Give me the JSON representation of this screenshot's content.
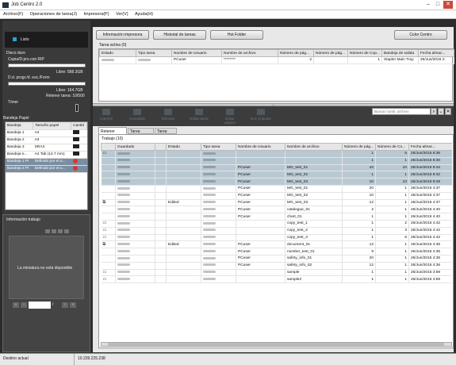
{
  "app": {
    "title": "Job Centro 2.0"
  },
  "window_controls": {
    "min": "–",
    "max": "□",
    "close": "✕"
  },
  "menu": [
    "Archivo(F)",
    "Operaciones de tarea(J)",
    "Impresora(P)",
    "Ver(V)",
    "Ayuda(H)"
  ],
  "left": {
    "status": "Listo",
    "disco_duro": "Disco duro",
    "copia_label": "Copia/D.pro.con RIP",
    "libre1": "Libre: 588.3GB",
    "dd_label": "D.d. progr./d. esc./Form",
    "libre2": "Libre: 164.7GB",
    "retener": "Retener tarea: 10/500",
    "toner": "Tóner",
    "bandeja_title": "Bandeja Papel",
    "bandeja_headers": [
      "Bandeja",
      "Tamaño papel",
      "Cantid"
    ],
    "bandejas": [
      [
        "Bandeja 1",
        "A4"
      ],
      [
        "Bandeja 2",
        "A3"
      ],
      [
        "Bandeja 3",
        "SRA3"
      ],
      [
        "Bandeja e...",
        "A4 Tab (12.7 mm)"
      ],
      [
        "Bandeja 1 PI",
        "Definido por el u..."
      ],
      [
        "Bandeja 2 PI",
        "Definido por el u..."
      ]
    ],
    "info_title": "Información trabajo",
    "miniatura": "La miniatura no está disponible",
    "page_sep": "/"
  },
  "toolbar": {
    "info": "Información impresora",
    "hist": "Historial de tareas",
    "hot": "Hot Folder",
    "color": "Color Centro"
  },
  "active": {
    "title": "Tarea activa (0)",
    "headers": [
      "Estado",
      "Tipo tarea",
      "Nombre de Usuario",
      "Nombre de archivo",
      "Número de pág...",
      "Número de pág...",
      "Número de Cop...",
      "Bandeja de salida",
      "Fecha almac..."
    ],
    "row": [
      "",
      "",
      "PCuser",
      "********",
      "2",
      "",
      "1",
      "Stapler Main Tray",
      "26/Jun/2015 2:"
    ]
  },
  "actions": [
    "Imprimir",
    "Guardado",
    "Eliminar",
    "Editar tarea",
    "Editar página",
    "Enc el ajuste"
  ],
  "search": {
    "placeholder": "Buscar nomb. archivo"
  },
  "tabs": [
    "Retener tarea",
    "Tarea segura",
    "Tarea HDD"
  ],
  "trabajo": "Trabajo (10)",
  "jobs": {
    "headers": [
      "",
      "Guardado",
      "",
      "Estado",
      "Tipo tarea",
      "Nombre de Usuario",
      "Nombre de archivo",
      "Número de pág...",
      "Número de Co...",
      "Fecha almac..."
    ],
    "rows": [
      {
        "ic": "▭",
        "st": "",
        "u": "",
        "f": "",
        "p": "1",
        "c": "5",
        "d": "26/Jun/2015 8:36",
        "hl": true
      },
      {
        "ic": "",
        "st": "",
        "u": "",
        "f": "",
        "p": "1",
        "c": "1",
        "d": "26/Jun/2015 8:30",
        "hl": true
      },
      {
        "ic": "",
        "st": "",
        "u": "PCuser",
        "f": "MG_test_01",
        "p": "10",
        "c": "10",
        "d": "26/Jun/2015 8:34",
        "hl": true
      },
      {
        "ic": "",
        "st": "",
        "u": "PCuser",
        "f": "MG_test_02",
        "p": "1",
        "c": "1",
        "d": "26/Jun/2015 8:32",
        "hl": true
      },
      {
        "ic": "",
        "st": "",
        "u": "PCuser",
        "f": "MG_test_03",
        "p": "10",
        "c": "10",
        "d": "26/Jun/2015 8:29",
        "hl": true
      },
      {
        "ic": "",
        "st": "",
        "u": "PCuser",
        "f": "MG_test_01",
        "p": "20",
        "c": "1",
        "d": "26/Jun/2015 4:37"
      },
      {
        "ic": "",
        "st": "",
        "u": "PCuser",
        "f": "MG_test_02",
        "p": "10",
        "c": "1",
        "d": "26/Jun/2015 4:37"
      },
      {
        "ic": "⧉",
        "st": "Edited",
        "u": "PCuser",
        "f": "MG_test_03",
        "p": "12",
        "c": "1",
        "d": "26/Jun/2015 4:37"
      },
      {
        "ic": "",
        "st": "",
        "u": "PCuser",
        "f": "catalogue_01",
        "p": "2",
        "c": "1",
        "d": "26/Jun/2015 4:40"
      },
      {
        "ic": "",
        "st": "",
        "u": "PCuser",
        "f": "chart_01",
        "p": "1",
        "c": "1",
        "d": "26/Jun/2015 4:40"
      },
      {
        "ic": "▭",
        "st": "",
        "u": "",
        "f": "copy_test_1",
        "p": "1",
        "c": "2",
        "d": "26/Jun/2015 4:42"
      },
      {
        "ic": "▭",
        "st": "",
        "u": "",
        "f": "copy_test_2",
        "p": "1",
        "c": "3",
        "d": "26/Jun/2015 4:42"
      },
      {
        "ic": "▭",
        "st": "",
        "u": "",
        "f": "copy_test_3",
        "p": "1",
        "c": "6",
        "d": "26/Jun/2015 4:42"
      },
      {
        "ic": "⧉",
        "st": "Edited",
        "u": "PCuser",
        "f": "document_01",
        "p": "12",
        "c": "1",
        "d": "26/Jun/2015 4:35"
      },
      {
        "ic": "",
        "st": "",
        "u": "PCuser",
        "f": "number_test_01",
        "p": "9",
        "c": "1",
        "d": "26/Jun/2015 4:35"
      },
      {
        "ic": "",
        "st": "",
        "u": "PCuser",
        "f": "safety_info_01",
        "p": "20",
        "c": "1",
        "d": "26/Jun/2015 4:36"
      },
      {
        "ic": "",
        "st": "",
        "u": "PCuser",
        "f": "safety_info_02",
        "p": "12",
        "c": "1",
        "d": "26/Jun/2015 4:36"
      },
      {
        "ic": "▭",
        "st": "",
        "u": "",
        "f": "sample",
        "p": "1",
        "c": "1",
        "d": "26/Jun/2015 3:59"
      },
      {
        "ic": "▭",
        "st": "",
        "u": "",
        "f": "sample2",
        "p": "1",
        "c": "1",
        "d": "26/Jun/2015 3:59"
      }
    ]
  },
  "status": {
    "label": "Destino actual",
    "ip": "10.239.225.238"
  }
}
